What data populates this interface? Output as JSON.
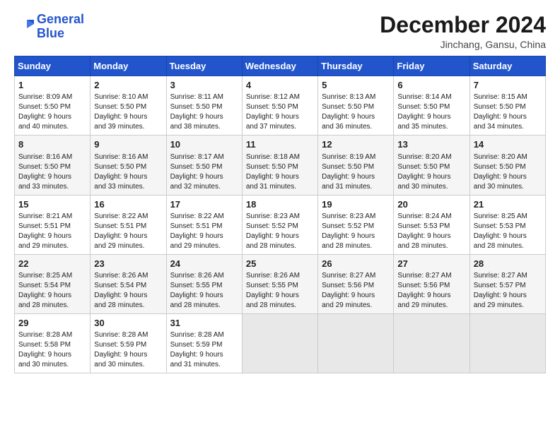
{
  "logo": {
    "line1": "General",
    "line2": "Blue"
  },
  "title": {
    "month_year": "December 2024",
    "location": "Jinchang, Gansu, China"
  },
  "days_of_week": [
    "Sunday",
    "Monday",
    "Tuesday",
    "Wednesday",
    "Thursday",
    "Friday",
    "Saturday"
  ],
  "weeks": [
    [
      {
        "day": 1,
        "sunrise": "8:09 AM",
        "sunset": "5:50 PM",
        "daylight": "9 hours and 40 minutes."
      },
      {
        "day": 2,
        "sunrise": "8:10 AM",
        "sunset": "5:50 PM",
        "daylight": "9 hours and 39 minutes."
      },
      {
        "day": 3,
        "sunrise": "8:11 AM",
        "sunset": "5:50 PM",
        "daylight": "9 hours and 38 minutes."
      },
      {
        "day": 4,
        "sunrise": "8:12 AM",
        "sunset": "5:50 PM",
        "daylight": "9 hours and 37 minutes."
      },
      {
        "day": 5,
        "sunrise": "8:13 AM",
        "sunset": "5:50 PM",
        "daylight": "9 hours and 36 minutes."
      },
      {
        "day": 6,
        "sunrise": "8:14 AM",
        "sunset": "5:50 PM",
        "daylight": "9 hours and 35 minutes."
      },
      {
        "day": 7,
        "sunrise": "8:15 AM",
        "sunset": "5:50 PM",
        "daylight": "9 hours and 34 minutes."
      }
    ],
    [
      {
        "day": 8,
        "sunrise": "8:16 AM",
        "sunset": "5:50 PM",
        "daylight": "9 hours and 33 minutes."
      },
      {
        "day": 9,
        "sunrise": "8:16 AM",
        "sunset": "5:50 PM",
        "daylight": "9 hours and 33 minutes."
      },
      {
        "day": 10,
        "sunrise": "8:17 AM",
        "sunset": "5:50 PM",
        "daylight": "9 hours and 32 minutes."
      },
      {
        "day": 11,
        "sunrise": "8:18 AM",
        "sunset": "5:50 PM",
        "daylight": "9 hours and 31 minutes."
      },
      {
        "day": 12,
        "sunrise": "8:19 AM",
        "sunset": "5:50 PM",
        "daylight": "9 hours and 31 minutes."
      },
      {
        "day": 13,
        "sunrise": "8:20 AM",
        "sunset": "5:50 PM",
        "daylight": "9 hours and 30 minutes."
      },
      {
        "day": 14,
        "sunrise": "8:20 AM",
        "sunset": "5:50 PM",
        "daylight": "9 hours and 30 minutes."
      }
    ],
    [
      {
        "day": 15,
        "sunrise": "8:21 AM",
        "sunset": "5:51 PM",
        "daylight": "9 hours and 29 minutes."
      },
      {
        "day": 16,
        "sunrise": "8:22 AM",
        "sunset": "5:51 PM",
        "daylight": "9 hours and 29 minutes."
      },
      {
        "day": 17,
        "sunrise": "8:22 AM",
        "sunset": "5:51 PM",
        "daylight": "9 hours and 29 minutes."
      },
      {
        "day": 18,
        "sunrise": "8:23 AM",
        "sunset": "5:52 PM",
        "daylight": "9 hours and 28 minutes."
      },
      {
        "day": 19,
        "sunrise": "8:23 AM",
        "sunset": "5:52 PM",
        "daylight": "9 hours and 28 minutes."
      },
      {
        "day": 20,
        "sunrise": "8:24 AM",
        "sunset": "5:53 PM",
        "daylight": "9 hours and 28 minutes."
      },
      {
        "day": 21,
        "sunrise": "8:25 AM",
        "sunset": "5:53 PM",
        "daylight": "9 hours and 28 minutes."
      }
    ],
    [
      {
        "day": 22,
        "sunrise": "8:25 AM",
        "sunset": "5:54 PM",
        "daylight": "9 hours and 28 minutes."
      },
      {
        "day": 23,
        "sunrise": "8:26 AM",
        "sunset": "5:54 PM",
        "daylight": "9 hours and 28 minutes."
      },
      {
        "day": 24,
        "sunrise": "8:26 AM",
        "sunset": "5:55 PM",
        "daylight": "9 hours and 28 minutes."
      },
      {
        "day": 25,
        "sunrise": "8:26 AM",
        "sunset": "5:55 PM",
        "daylight": "9 hours and 28 minutes."
      },
      {
        "day": 26,
        "sunrise": "8:27 AM",
        "sunset": "5:56 PM",
        "daylight": "9 hours and 29 minutes."
      },
      {
        "day": 27,
        "sunrise": "8:27 AM",
        "sunset": "5:56 PM",
        "daylight": "9 hours and 29 minutes."
      },
      {
        "day": 28,
        "sunrise": "8:27 AM",
        "sunset": "5:57 PM",
        "daylight": "9 hours and 29 minutes."
      }
    ],
    [
      {
        "day": 29,
        "sunrise": "8:28 AM",
        "sunset": "5:58 PM",
        "daylight": "9 hours and 30 minutes."
      },
      {
        "day": 30,
        "sunrise": "8:28 AM",
        "sunset": "5:59 PM",
        "daylight": "9 hours and 30 minutes."
      },
      {
        "day": 31,
        "sunrise": "8:28 AM",
        "sunset": "5:59 PM",
        "daylight": "9 hours and 31 minutes."
      },
      null,
      null,
      null,
      null
    ]
  ]
}
